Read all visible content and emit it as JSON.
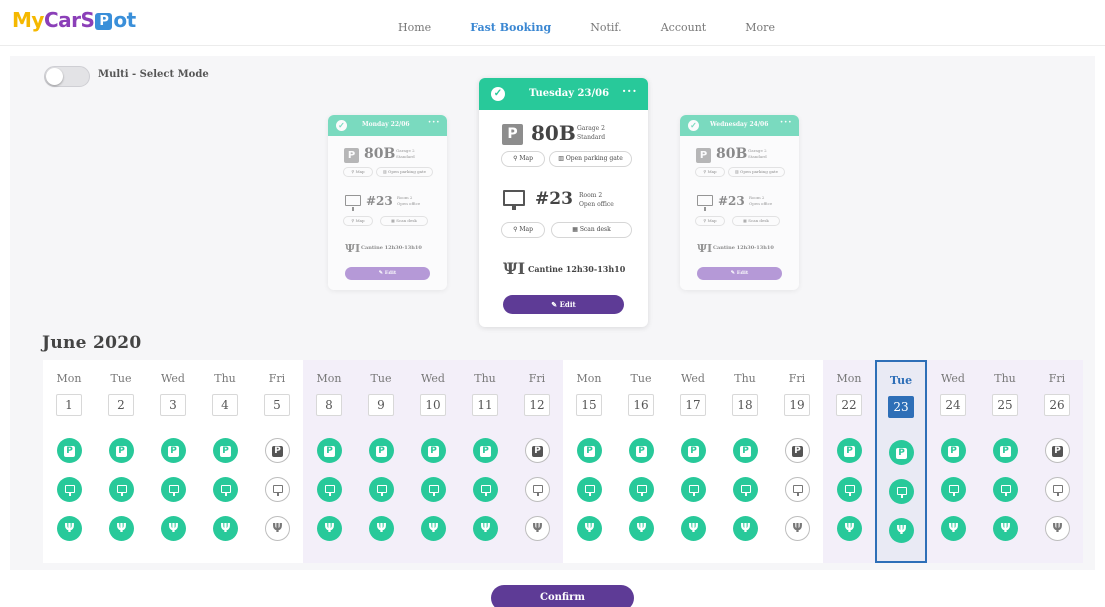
{
  "app": {
    "logo_my": "My",
    "logo_car": "CarS",
    "logo_pin": "P",
    "logo_ot": "ot"
  },
  "nav": {
    "items": [
      {
        "label": "Home"
      },
      {
        "label": "Fast Booking",
        "active": true
      },
      {
        "label": "Notif."
      },
      {
        "label": "Account"
      },
      {
        "label": "More"
      }
    ]
  },
  "multiselect": {
    "label": "Multi - Select Mode",
    "enabled": false
  },
  "cards": {
    "prev": {
      "date": "Monday 22/06",
      "dots": "···",
      "parking_letter": "P",
      "parking_spot": "80B",
      "parking_line1": "Garage 2",
      "parking_line2": "Standard",
      "map_label": "Map",
      "gate_label": "Open parking gate",
      "desk_number": "#23",
      "desk_line1": "Room 2",
      "desk_line2": "Open office",
      "scan_label": "Scan desk",
      "cantine": "Cantine 12h30-13h10",
      "edit_label": "Edit"
    },
    "current": {
      "date": "Tuesday 23/06",
      "dots": "···",
      "parking_letter": "P",
      "parking_spot": "80B",
      "parking_line1": "Garage 2",
      "parking_line2": "Standard",
      "map_label": "Map",
      "gate_label": "Open parking gate",
      "desk_number": "#23",
      "desk_line1": "Room 2",
      "desk_line2": "Open office",
      "scan_label": "Scan desk",
      "cantine": "Cantine 12h30-13h10",
      "edit_label": "Edit"
    },
    "next": {
      "date": "Wednesday 24/06",
      "dots": "···",
      "parking_letter": "P",
      "parking_spot": "80B",
      "parking_line1": "Garage 2",
      "parking_line2": "Standard",
      "map_label": "Map",
      "gate_label": "Open parking gate",
      "desk_number": "#23",
      "desk_line1": "Room 2",
      "desk_line2": "Open office",
      "scan_label": "Scan desk",
      "cantine": "Cantine 12h30-13h10",
      "edit_label": "Edit"
    }
  },
  "calendar": {
    "month": "June 2020",
    "selected_day": "23",
    "days": [
      {
        "dow": "Mon",
        "num": "1",
        "booked": true
      },
      {
        "dow": "Tue",
        "num": "2",
        "booked": true
      },
      {
        "dow": "Wed",
        "num": "3",
        "booked": true
      },
      {
        "dow": "Thu",
        "num": "4",
        "booked": true
      },
      {
        "dow": "Fri",
        "num": "5",
        "booked": false
      },
      {
        "dow": "Mon",
        "num": "8",
        "booked": true
      },
      {
        "dow": "Tue",
        "num": "9",
        "booked": true
      },
      {
        "dow": "Wed",
        "num": "10",
        "booked": true
      },
      {
        "dow": "Thu",
        "num": "11",
        "booked": true
      },
      {
        "dow": "Fri",
        "num": "12",
        "booked": false
      },
      {
        "dow": "Mon",
        "num": "15",
        "booked": true
      },
      {
        "dow": "Tue",
        "num": "16",
        "booked": true
      },
      {
        "dow": "Wed",
        "num": "17",
        "booked": true
      },
      {
        "dow": "Thu",
        "num": "18",
        "booked": true
      },
      {
        "dow": "Fri",
        "num": "19",
        "booked": false
      },
      {
        "dow": "Mon",
        "num": "22",
        "booked": true
      },
      {
        "dow": "Tue",
        "num": "23",
        "booked": true
      },
      {
        "dow": "Wed",
        "num": "24",
        "booked": true
      },
      {
        "dow": "Thu",
        "num": "25",
        "booked": true
      },
      {
        "dow": "Fri",
        "num": "26",
        "booked": false
      }
    ]
  },
  "confirm_label": "Confirm",
  "colors": {
    "accent_green": "#28c99a",
    "accent_purple": "#5e3b96",
    "nav_active": "#3a87d2",
    "selected_blue": "#2e6fb7"
  },
  "icons": {
    "parking": "parking-icon",
    "desk": "monitor-icon",
    "cantine": "fork-knife-icon",
    "check": "check-icon",
    "map": "map-pin-icon",
    "gate": "gate-icon",
    "scan": "qr-code-icon",
    "edit": "pencil-icon"
  }
}
